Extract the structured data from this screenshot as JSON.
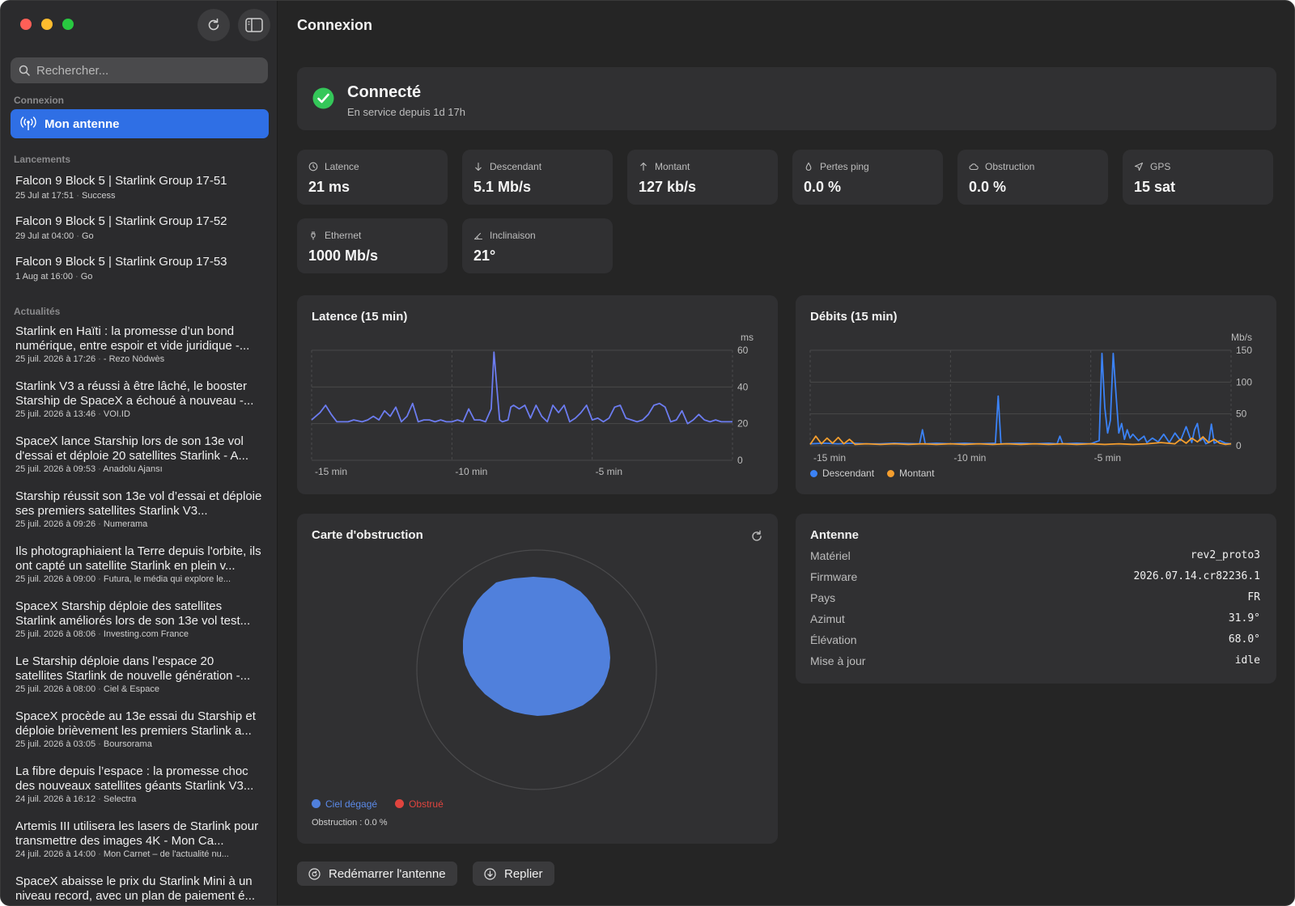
{
  "toolbar": {
    "refresh_icon": "refresh-icon",
    "sidebar_toggle_icon": "sidebar-toggle-icon"
  },
  "search": {
    "placeholder": "Rechercher..."
  },
  "sidebar": {
    "connexion_title": "Connexion",
    "selected_item": "Mon antenne",
    "launches_title": "Lancements",
    "launches": [
      {
        "title": "Falcon 9 Block 5 | Starlink Group 17-51",
        "date": "25 Jul at 17:51",
        "status": "Success"
      },
      {
        "title": "Falcon 9 Block 5 | Starlink Group 17-52",
        "date": "29 Jul at 04:00",
        "status": "Go"
      },
      {
        "title": "Falcon 9 Block 5 | Starlink Group 17-53",
        "date": "1 Aug at 16:00",
        "status": "Go"
      }
    ],
    "news_title": "Actualités",
    "news": [
      {
        "title": "Starlink en Haïti : la promesse d’un bond numérique, entre espoir et vide juridique -...",
        "date": "25 juil. 2026 à 17:26",
        "source": "- Rezo Nòdwès"
      },
      {
        "title": "Starlink V3 a réussi à être lâché, le booster Starship de SpaceX a échoué à nouveau -...",
        "date": "25 juil. 2026 à 13:46",
        "source": "VOI.ID"
      },
      {
        "title": "SpaceX lance Starship lors de son 13e vol d'essai et déploie 20 satellites Starlink - A...",
        "date": "25 juil. 2026 à 09:53",
        "source": "Anadolu Ajansı"
      },
      {
        "title": "Starship réussit son 13e vol d’essai et déploie ses premiers satellites Starlink V3...",
        "date": "25 juil. 2026 à 09:26",
        "source": "Numerama"
      },
      {
        "title": "Ils photographiaient la Terre depuis l'orbite, ils ont capté un satellite Starlink en plein v...",
        "date": "25 juil. 2026 à 09:00",
        "source": "Futura, le média qui explore le..."
      },
      {
        "title": "SpaceX Starship déploie des satellites Starlink améliorés lors de son 13e vol test...",
        "date": "25 juil. 2026 à 08:06",
        "source": "Investing.com France"
      },
      {
        "title": "Le Starship déploie dans l’espace 20 satellites Starlink de nouvelle génération -...",
        "date": "25 juil. 2026 à 08:00",
        "source": "Ciel & Espace"
      },
      {
        "title": "SpaceX procède au 13e essai du Starship et déploie brièvement les premiers Starlink a...",
        "date": "25 juil. 2026 à 03:05",
        "source": "Boursorama"
      },
      {
        "title": "La fibre depuis l’espace : la promesse choc des nouveaux satellites géants Starlink V3...",
        "date": "24 juil. 2026 à 16:12",
        "source": "Selectra"
      },
      {
        "title": "Artemis III utilisera les lasers de Starlink pour transmettre des images 4K - Mon Ca...",
        "date": "24 juil. 2026 à 14:00",
        "source": "Mon Carnet – de l'actualité nu..."
      },
      {
        "title": "SpaceX abaisse le prix du Starlink Mini à un niveau record, avec un plan de paiement é...",
        "date": "",
        "source": ""
      }
    ]
  },
  "main": {
    "title": "Connexion",
    "status": {
      "title": "Connecté",
      "subtitle": "En service depuis 1d 17h"
    },
    "stats": [
      {
        "label": "Latence",
        "value": "21 ms",
        "icon": "clock-icon"
      },
      {
        "label": "Descendant",
        "value": "5.1 Mb/s",
        "icon": "arrow-down-icon"
      },
      {
        "label": "Montant",
        "value": "127 kb/s",
        "icon": "arrow-up-icon"
      },
      {
        "label": "Pertes ping",
        "value": "0.0 %",
        "icon": "drop-icon"
      },
      {
        "label": "Obstruction",
        "value": "0.0 %",
        "icon": "cloud-icon"
      },
      {
        "label": "GPS",
        "value": "15 sat",
        "icon": "location-arrow-icon"
      },
      {
        "label": "Ethernet",
        "value": "1000 Mb/s",
        "icon": "plug-icon"
      },
      {
        "label": "Inclinaison",
        "value": "21°",
        "icon": "angle-icon"
      }
    ],
    "obstruction": {
      "title": "Carte d'obstruction",
      "legend_clear": "Ciel dégagé",
      "legend_obstructed": "Obstrué",
      "footer": "Obstruction : 0.0 %",
      "colors": {
        "clear": "#5080dc",
        "obstructed": "#e0443e"
      }
    },
    "antenna": {
      "title": "Antenne",
      "rows": [
        {
          "key": "Matériel",
          "value": "rev2_proto3"
        },
        {
          "key": "Firmware",
          "value": "2026.07.14.cr82236.1"
        },
        {
          "key": "Pays",
          "value": "FR"
        },
        {
          "key": "Azimut",
          "value": "31.9°"
        },
        {
          "key": "Élévation",
          "value": "68.0°"
        },
        {
          "key": "Mise à jour",
          "value": "idle"
        }
      ]
    },
    "buttons": {
      "restart": "Redémarrer l'antenne",
      "collapse": "Replier"
    }
  },
  "colors": {
    "accent": "#2f6fe5",
    "connected": "#34c759",
    "download": "#3b82f6",
    "upload": "#f59e2e",
    "latency": "#6c7cf0"
  },
  "chart_data": [
    {
      "type": "line",
      "title": "Latence (15 min)",
      "ylabel": "ms",
      "ylim": [
        0,
        60
      ],
      "xlim": [
        -15,
        0
      ],
      "x_ticks": [
        "-15 min",
        "-10 min",
        "-5 min"
      ],
      "y_ticks": [
        0,
        20,
        40,
        60
      ],
      "series": [
        {
          "color": "#6c7cf0",
          "x": [
            -15.0,
            -14.7,
            -14.5,
            -14.3,
            -14.1,
            -13.9,
            -13.7,
            -13.5,
            -13.2,
            -13.0,
            -12.8,
            -12.6,
            -12.4,
            -12.2,
            -12.0,
            -11.8,
            -11.6,
            -11.4,
            -11.2,
            -11.0,
            -10.8,
            -10.6,
            -10.4,
            -10.2,
            -10.0,
            -9.8,
            -9.6,
            -9.4,
            -9.2,
            -9.0,
            -8.8,
            -8.6,
            -8.5,
            -8.4,
            -8.3,
            -8.2,
            -8.0,
            -7.9,
            -7.8,
            -7.6,
            -7.4,
            -7.2,
            -7.0,
            -6.8,
            -6.6,
            -6.4,
            -6.2,
            -6.0,
            -5.8,
            -5.6,
            -5.4,
            -5.2,
            -5.0,
            -4.8,
            -4.6,
            -4.4,
            -4.2,
            -4.0,
            -3.8,
            -3.6,
            -3.4,
            -3.2,
            -3.0,
            -2.8,
            -2.6,
            -2.4,
            -2.2,
            -2.0,
            -1.8,
            -1.6,
            -1.4,
            -1.2,
            -1.0,
            -0.8,
            -0.6,
            -0.4,
            -0.2,
            0.0
          ],
          "y": [
            22,
            26,
            30,
            25,
            21,
            21,
            21,
            22,
            21,
            22,
            24,
            22,
            27,
            24,
            29,
            21,
            24,
            31,
            21,
            22,
            22,
            21,
            22,
            21,
            21,
            22,
            21,
            28,
            22,
            22,
            21,
            28,
            59,
            40,
            22,
            21,
            22,
            29,
            30,
            28,
            30,
            23,
            30,
            24,
            21,
            30,
            26,
            30,
            21,
            23,
            26,
            30,
            22,
            23,
            21,
            23,
            29,
            30,
            23,
            22,
            21,
            22,
            25,
            30,
            31,
            29,
            21,
            22,
            27,
            20,
            22,
            25,
            22,
            21,
            22,
            21,
            21,
            21
          ]
        }
      ]
    },
    {
      "type": "line",
      "title": "Débits (15 min)",
      "ylabel": "Mb/s",
      "ylim": [
        0,
        150
      ],
      "xlim": [
        -15,
        0
      ],
      "x_ticks": [
        "-15 min",
        "-10 min",
        "-5 min"
      ],
      "y_ticks": [
        0,
        50,
        100,
        150
      ],
      "series": [
        {
          "name": "Descendant",
          "color": "#3b82f6",
          "x": [
            -15.0,
            -14.5,
            -14.0,
            -13.5,
            -13.0,
            -12.5,
            -12.0,
            -11.1,
            -11.0,
            -10.9,
            -10.5,
            -10.0,
            -9.5,
            -9.0,
            -8.4,
            -8.3,
            -8.2,
            -7.5,
            -7.0,
            -6.5,
            -6.2,
            -6.1,
            -6.0,
            -5.5,
            -5.0,
            -4.7,
            -4.6,
            -4.5,
            -4.4,
            -4.3,
            -4.2,
            -4.1,
            -4.0,
            -3.9,
            -3.8,
            -3.7,
            -3.6,
            -3.5,
            -3.3,
            -3.1,
            -3.0,
            -2.8,
            -2.6,
            -2.4,
            -2.2,
            -2.0,
            -1.8,
            -1.6,
            -1.4,
            -1.3,
            -1.2,
            -1.1,
            -1.0,
            -0.9,
            -0.8,
            -0.7,
            -0.6,
            -0.4,
            -0.2,
            0.0
          ],
          "y": [
            3,
            4,
            3,
            4,
            3,
            3,
            4,
            3,
            25,
            3,
            4,
            3,
            4,
            3,
            4,
            78,
            3,
            4,
            3,
            4,
            3,
            15,
            3,
            4,
            3,
            8,
            145,
            60,
            20,
            40,
            145,
            80,
            20,
            35,
            10,
            25,
            12,
            18,
            8,
            15,
            5,
            12,
            6,
            18,
            5,
            20,
            8,
            30,
            5,
            25,
            35,
            8,
            12,
            3,
            5,
            34,
            4,
            8,
            4,
            3
          ]
        },
        {
          "name": "Montant",
          "color": "#f59e2e",
          "x": [
            -15.0,
            -14.8,
            -14.6,
            -14.4,
            -14.2,
            -14.0,
            -13.8,
            -13.6,
            -13.4,
            -13.0,
            -12.5,
            -12.0,
            -11.5,
            -11.0,
            -10.5,
            -10.0,
            -9.5,
            -9.0,
            -8.5,
            -8.0,
            -7.5,
            -7.0,
            -6.5,
            -6.0,
            -5.5,
            -5.0,
            -4.5,
            -4.0,
            -3.5,
            -3.0,
            -2.5,
            -2.0,
            -1.8,
            -1.6,
            -1.4,
            -1.2,
            -1.0,
            -0.8,
            -0.6,
            -0.4,
            -0.2,
            0.0
          ],
          "y": [
            2,
            15,
            3,
            12,
            4,
            13,
            3,
            10,
            2,
            3,
            2,
            3,
            2,
            3,
            2,
            3,
            2,
            3,
            2,
            3,
            2,
            3,
            2,
            3,
            2,
            3,
            2,
            3,
            2,
            3,
            5,
            3,
            10,
            4,
            12,
            6,
            14,
            5,
            10,
            4,
            2,
            3
          ]
        }
      ]
    }
  ]
}
